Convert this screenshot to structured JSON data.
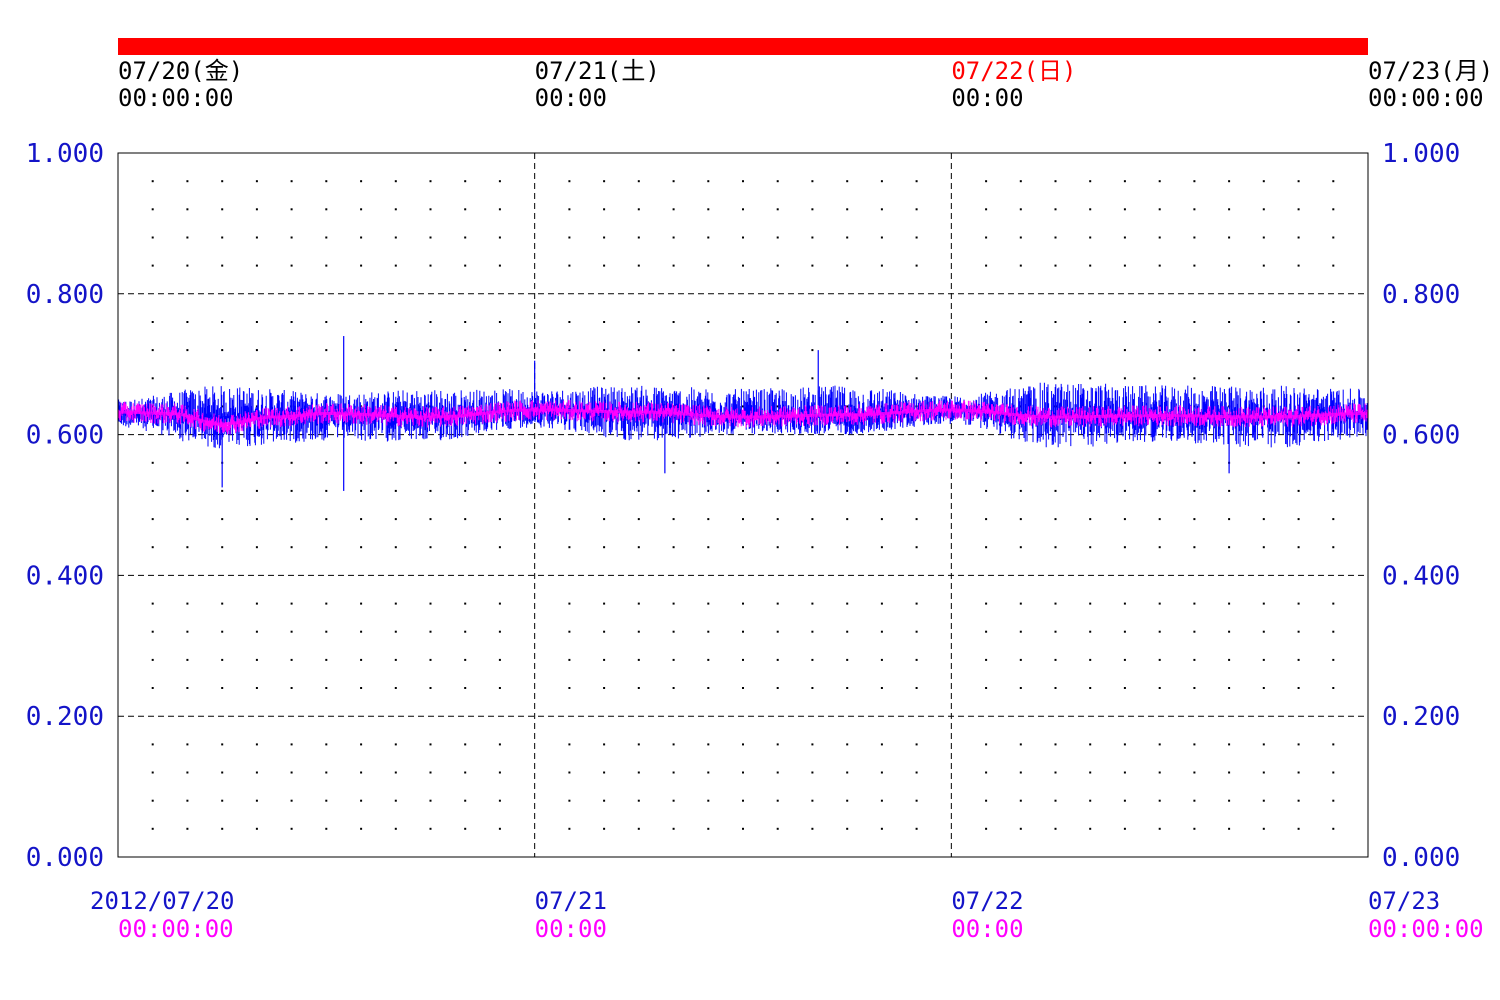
{
  "colors": {
    "top_bar": "#ff0000",
    "text_black": "#000000",
    "text_red": "#ff0000",
    "axis_blue": "#1414c8",
    "series_blue": "#0000ff",
    "series_magenta": "#ff00ff",
    "time_magenta": "#ff00ff",
    "grid": "#000000"
  },
  "top_labels": [
    {
      "date": "07/20(金)",
      "time": "00:00:00",
      "color": "black"
    },
    {
      "date": "07/21(土)",
      "time": "00:00",
      "color": "black"
    },
    {
      "date": "07/22(日)",
      "time": "00:00",
      "color": "red",
      "time_color": "black"
    },
    {
      "date": "07/23(月)",
      "time": "00:00:00",
      "color": "black"
    }
  ],
  "bottom_labels": [
    {
      "date": "2012/07/20",
      "time": "00:00:00"
    },
    {
      "date": "07/21",
      "time": "00:00"
    },
    {
      "date": "07/22",
      "time": "00:00"
    },
    {
      "date": "07/23",
      "time": "00:00:00"
    }
  ],
  "chart_data": {
    "type": "line",
    "title": "",
    "xlabel": "",
    "ylabel": "",
    "x_range": [
      "2012-07-20T00:00:00",
      "2012-07-23T00:00:00"
    ],
    "ylim": [
      0.0,
      1.0
    ],
    "y_ticks": [
      "0.000",
      "0.200",
      "0.400",
      "0.600",
      "0.800",
      "1.000"
    ],
    "y_tick_values": [
      0.0,
      0.2,
      0.4,
      0.6,
      0.8,
      1.0
    ],
    "grid": true,
    "legend": "none",
    "series": [
      {
        "color": "#0000ff",
        "style": "noisy-band",
        "x": [
          "2012-07-20T00:00",
          "2012-07-20T06:00",
          "2012-07-20T12:00",
          "2012-07-20T18:00",
          "2012-07-21T00:00",
          "2012-07-21T06:00",
          "2012-07-21T12:00",
          "2012-07-21T18:00",
          "2012-07-22T00:00",
          "2012-07-22T06:00",
          "2012-07-22T12:00",
          "2012-07-22T18:00",
          "2012-07-23T00:00"
        ],
        "values": [
          0.63,
          0.625,
          0.63,
          0.625,
          0.635,
          0.63,
          0.625,
          0.625,
          0.635,
          0.625,
          0.625,
          0.625,
          0.63
        ],
        "band_min": [
          0.61,
          0.58,
          0.59,
          0.59,
          0.61,
          0.59,
          0.6,
          0.6,
          0.615,
          0.58,
          0.59,
          0.58,
          0.595
        ],
        "band_max": [
          0.65,
          0.67,
          0.66,
          0.665,
          0.665,
          0.67,
          0.665,
          0.67,
          0.655,
          0.675,
          0.67,
          0.67,
          0.665
        ],
        "spikes": [
          {
            "x": "2012-07-20T06:00",
            "y": 0.525
          },
          {
            "x": "2012-07-20T13:00",
            "y": 0.74
          },
          {
            "x": "2012-07-20T13:00",
            "y": 0.52
          },
          {
            "x": "2012-07-21T00:00",
            "y": 0.705
          },
          {
            "x": "2012-07-21T07:30",
            "y": 0.545
          },
          {
            "x": "2012-07-21T16:20",
            "y": 0.72
          },
          {
            "x": "2012-07-22T16:00",
            "y": 0.545
          }
        ]
      },
      {
        "color": "#ff00ff",
        "style": "smooth",
        "x": [
          "2012-07-20T00:00",
          "2012-07-20T03:00",
          "2012-07-20T06:00",
          "2012-07-20T09:00",
          "2012-07-20T12:00",
          "2012-07-20T18:00",
          "2012-07-21T00:00",
          "2012-07-21T06:00",
          "2012-07-21T12:00",
          "2012-07-21T18:00",
          "2012-07-22T00:00",
          "2012-07-22T06:00",
          "2012-07-22T12:00",
          "2012-07-22T18:00",
          "2012-07-23T00:00"
        ],
        "values": [
          0.632,
          0.63,
          0.615,
          0.625,
          0.63,
          0.625,
          0.635,
          0.632,
          0.625,
          0.628,
          0.635,
          0.625,
          0.627,
          0.625,
          0.63
        ]
      }
    ]
  }
}
